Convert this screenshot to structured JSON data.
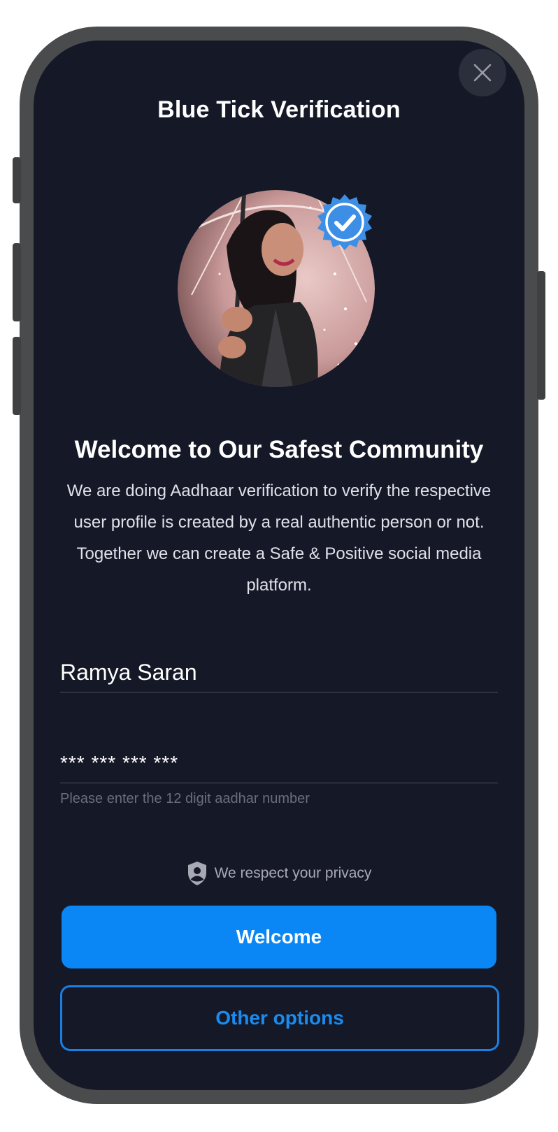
{
  "header": {
    "title": "Blue Tick Verification",
    "close_icon": "close-icon"
  },
  "profile": {
    "avatar_icon": "profile-photo",
    "badge_icon": "verified-badge-icon",
    "badge_color": "#3d8fe6"
  },
  "intro": {
    "heading": "Welcome to Our Safest Community",
    "description": "We are doing Aadhaar verification to verify the respective user profile is created by a real authentic person or not. Together we can create a Safe & Positive social media platform."
  },
  "form": {
    "name_value": "Ramya Saran",
    "aadhar_value": "*** *** *** ***",
    "aadhar_hint": "Please enter the 12 digit aadhar number"
  },
  "privacy": {
    "icon": "shield-user-icon",
    "text": "We respect your privacy"
  },
  "actions": {
    "primary_label": "Welcome",
    "secondary_label": "Other options",
    "primary_color": "#0a87f5"
  }
}
